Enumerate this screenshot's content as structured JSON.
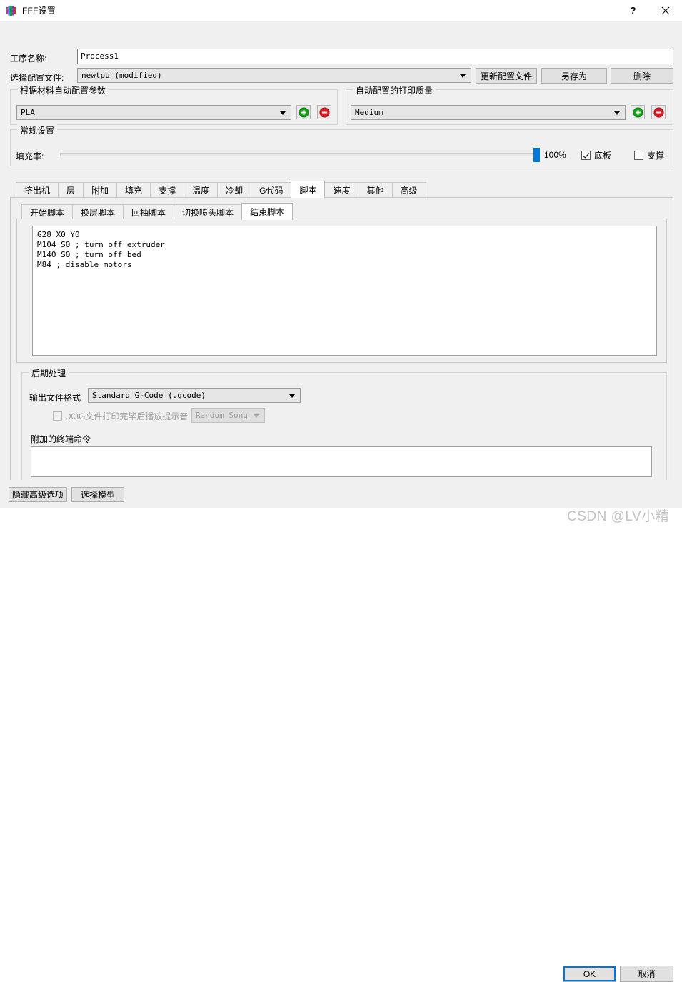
{
  "window": {
    "title": "FFF设置",
    "icon": "app-logo-bars-icon",
    "help_label": "?",
    "close_label": "✕"
  },
  "header": {
    "process_name_label": "工序名称:",
    "process_name_value": "Process1",
    "profile_label": "选择配置文件:",
    "profile_value": "newtpu (modified)",
    "update_profile_label": "更新配置文件",
    "save_as_label": "另存为",
    "delete_label": "删除"
  },
  "material_group": {
    "title": "根据材料自动配置参数",
    "value": "PLA",
    "add_label": "+",
    "remove_label": "−"
  },
  "quality_group": {
    "title": "自动配置的打印质量",
    "value": "Medium",
    "add_label": "+",
    "remove_label": "−"
  },
  "general_group": {
    "title": "常规设置",
    "infill_label": "填充率:",
    "infill_value": "100%",
    "infill_percent": 100,
    "raft_label": "底板",
    "raft_checked": true,
    "support_label": "支撑",
    "support_checked": false
  },
  "main_tabs": {
    "active_index": 8,
    "items": [
      {
        "label": "挤出机"
      },
      {
        "label": "层"
      },
      {
        "label": "附加"
      },
      {
        "label": "填充"
      },
      {
        "label": "支撑"
      },
      {
        "label": "温度"
      },
      {
        "label": "冷却"
      },
      {
        "label": "G代码"
      },
      {
        "label": "脚本"
      },
      {
        "label": "速度"
      },
      {
        "label": "其他"
      },
      {
        "label": "高级"
      }
    ]
  },
  "script_tabs": {
    "active_index": 4,
    "items": [
      {
        "label": "开始脚本"
      },
      {
        "label": "换层脚本"
      },
      {
        "label": "回抽脚本"
      },
      {
        "label": "切换喷头脚本"
      },
      {
        "label": "结束脚本"
      }
    ]
  },
  "script_editor": {
    "content": "G28 X0 Y0\nM104 S0 ; turn off extruder\nM140 S0 ; turn off bed\nM84 ; disable motors"
  },
  "post_process": {
    "title": "后期处理",
    "output_format_label": "输出文件格式",
    "output_format_value": "Standard G-Code (.gcode)",
    "x3g_label": ".X3G文件打印完毕后播放提示音",
    "x3g_checked": false,
    "song_value": "Random Song",
    "terminal_label": "附加的终端命令",
    "terminal_value": ""
  },
  "footer": {
    "hide_advanced_label": "隐藏高级选项",
    "select_model_label": "选择模型",
    "ok_label": "OK",
    "cancel_label": "取消"
  },
  "watermark": {
    "text": "CSDN @LV小精"
  }
}
